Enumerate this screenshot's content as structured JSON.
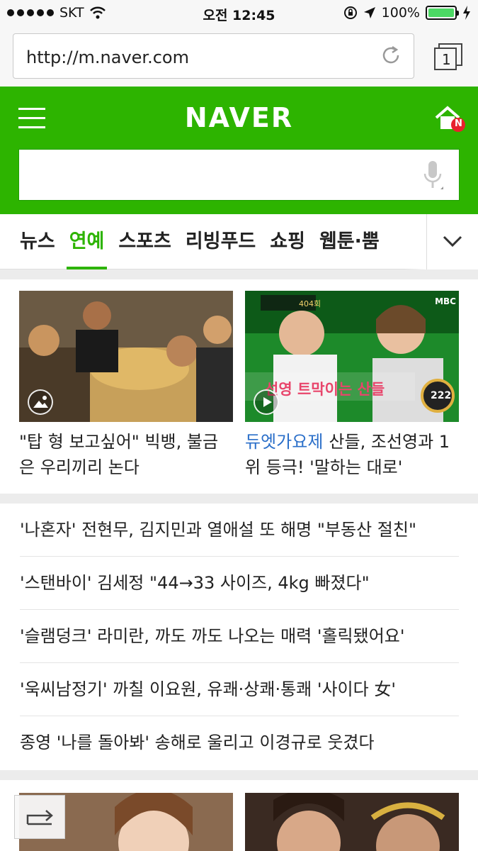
{
  "status_bar": {
    "carrier": "SKT",
    "time": "오전 12:45",
    "battery": "100%",
    "battery_level": 1.0
  },
  "browser": {
    "url": "http://m.naver.com",
    "tab_count": "1"
  },
  "header": {
    "logo": "NAVER",
    "home_badge": "N"
  },
  "search": {
    "placeholder": ""
  },
  "menu": {
    "items": [
      "뉴스",
      "연예",
      "스포츠",
      "리빙푸드",
      "쇼핑",
      "웹툰·뿜"
    ],
    "active": "연예"
  },
  "cards": [
    {
      "tag": "",
      "caption": "\"탑 형 보고싶어\" 빅뱅, 불금은 우리끼리 논다",
      "media": "photo-icon"
    },
    {
      "tag": "듀엣가요제",
      "caption": "산들, 조선영과 1위 등극! '말하는 대로'",
      "media": "play-icon",
      "overlay": {
        "badge": "404회",
        "caption": "선영 트막이는 산들",
        "score": "222",
        "channel": "MBC"
      }
    }
  ],
  "headlines": [
    "'나혼자' 전현무, 김지민과 열애설 또 해명 \"부동산 절친\"",
    "'스탠바이' 김세정 \"44→33 사이즈, 4kg 빠졌다\"",
    "'슬램덩크' 라미란, 까도 까도 나오는 매력 '홀릭됐어요'",
    "'욱씨남정기' 까칠 이요원, 유쾌·상쾌·통쾌 '사이다 女'",
    "종영 '나를 돌아봐' 송해로 울리고 이경규로 웃겼다"
  ],
  "colors": {
    "brand": "#2db400",
    "tag": "#2b6fc9"
  }
}
